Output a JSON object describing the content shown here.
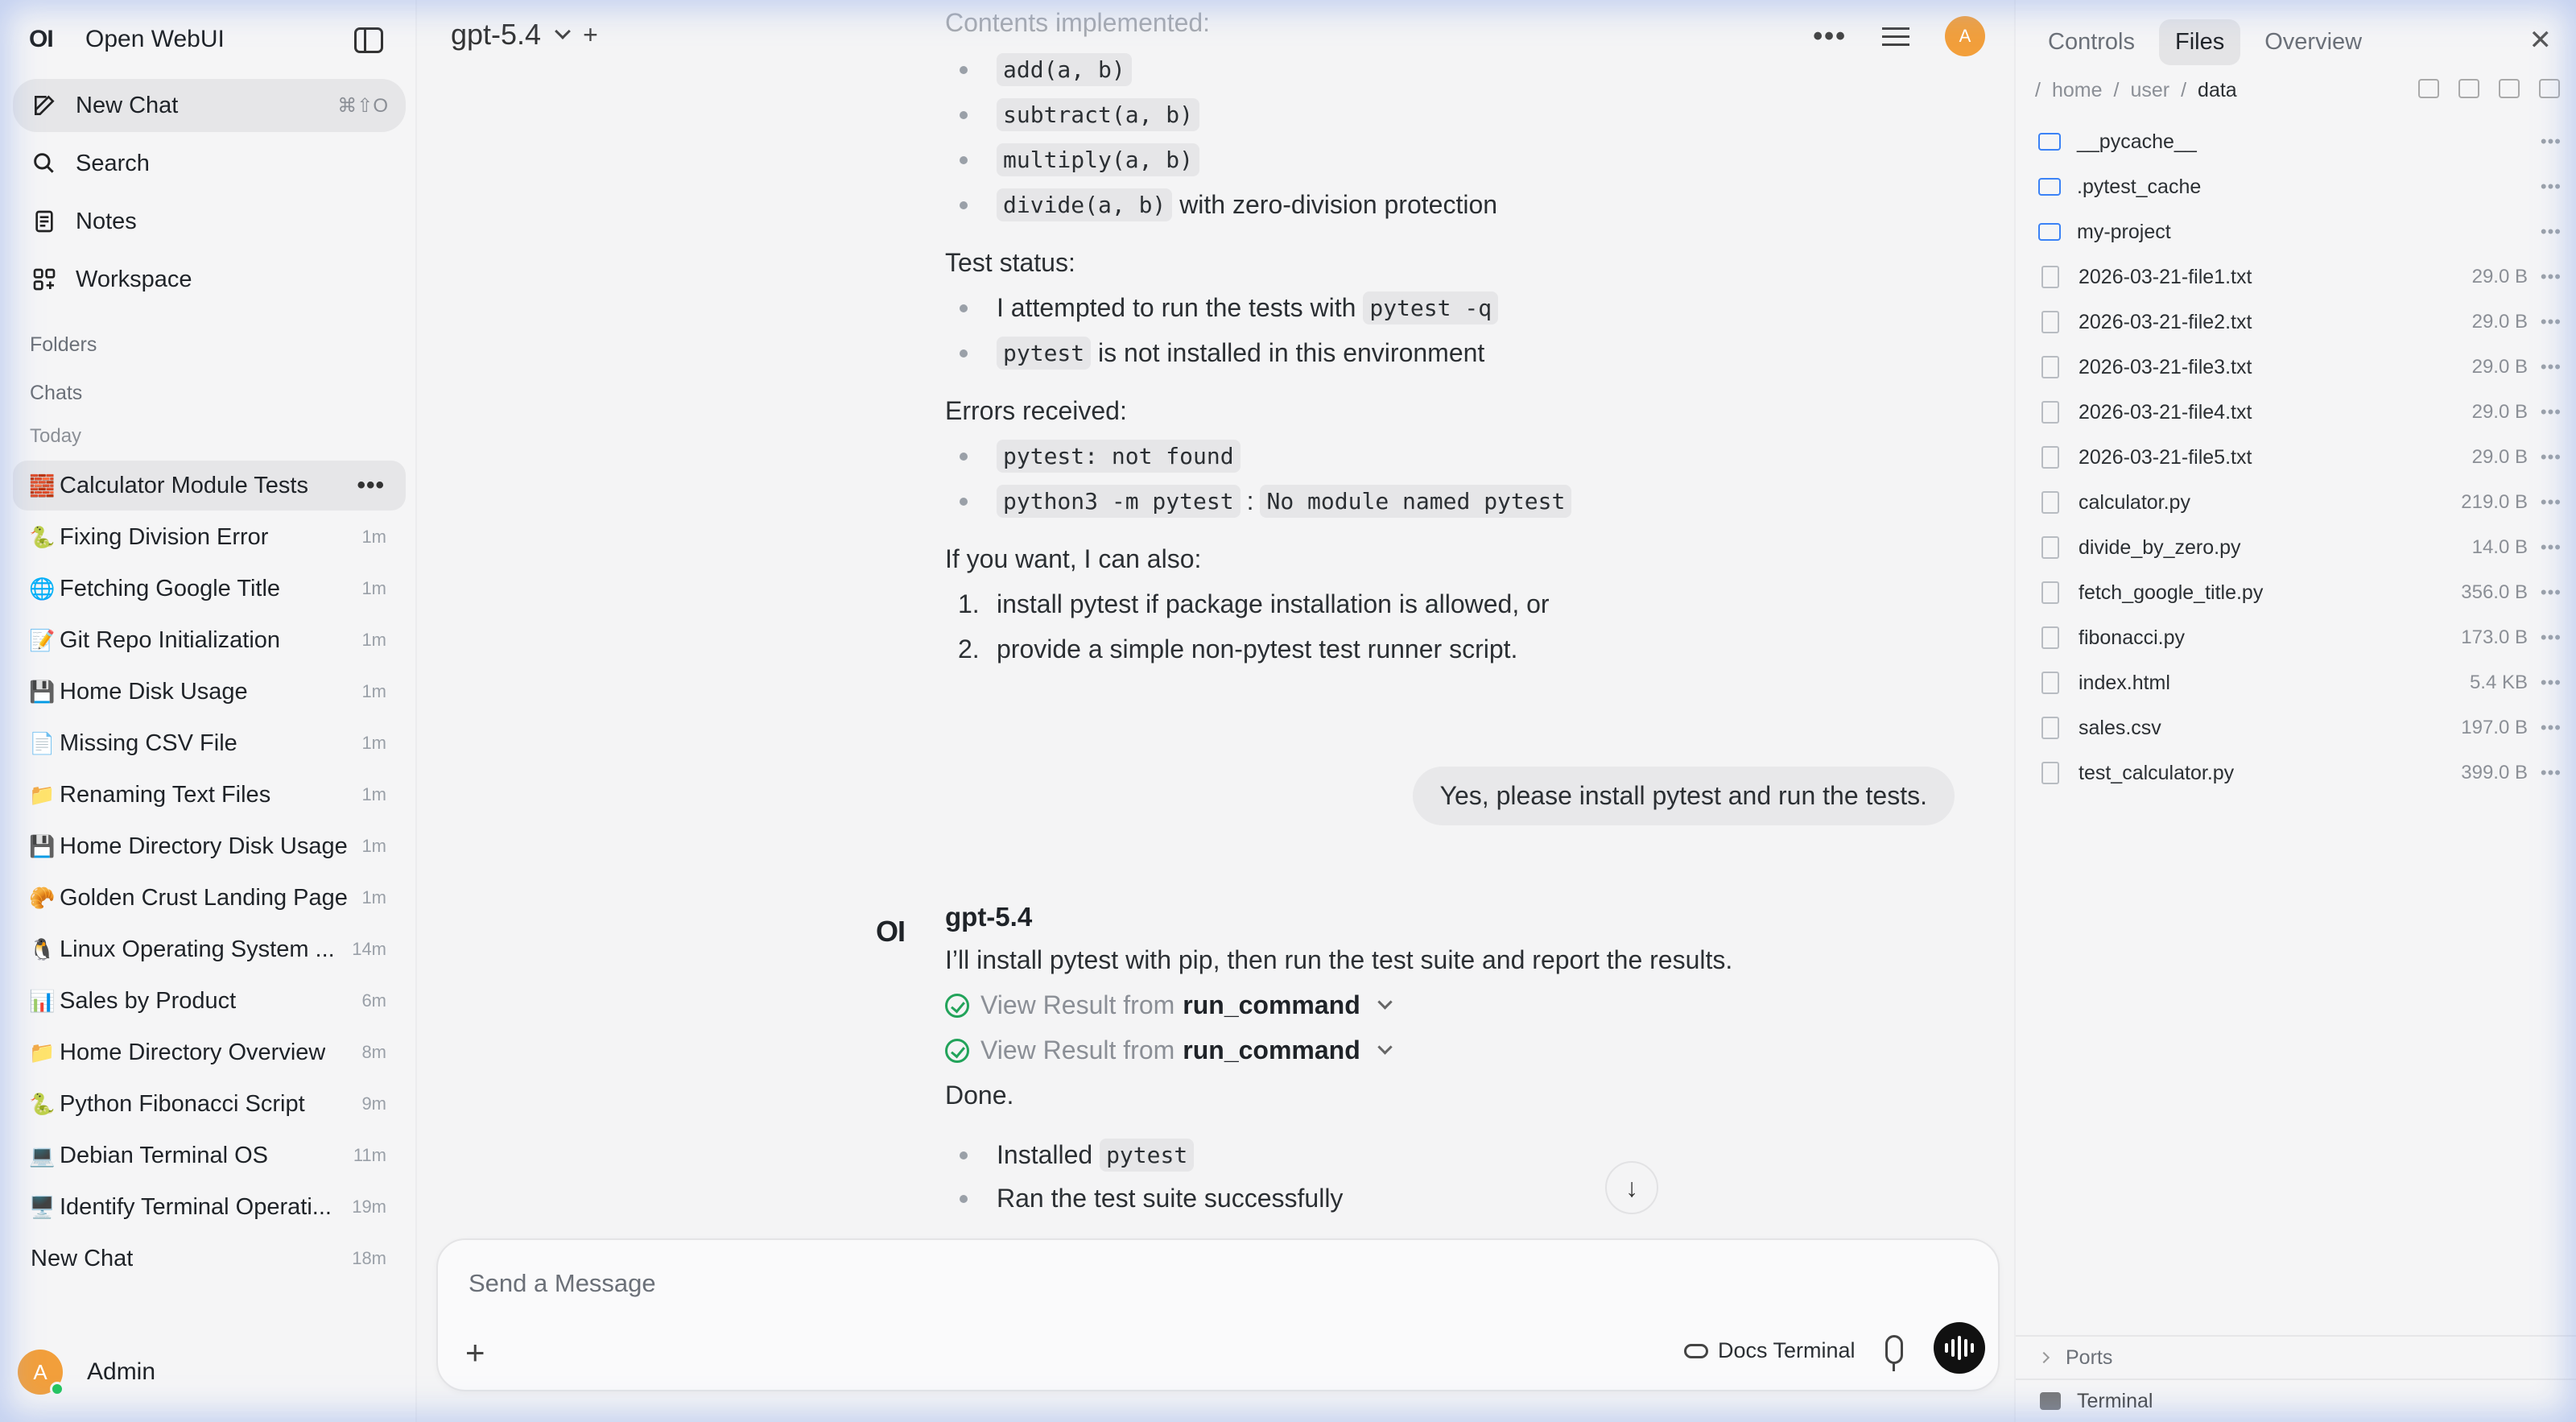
{
  "app": {
    "name": "Open WebUI",
    "logo": "OI"
  },
  "sidebar": {
    "nav": [
      {
        "label": "New Chat",
        "shortcut": "⌘⇧O",
        "icon": "edit-icon"
      },
      {
        "label": "Search",
        "icon": "search-icon"
      },
      {
        "label": "Notes",
        "icon": "notes-icon"
      },
      {
        "label": "Workspace",
        "icon": "workspace-icon"
      }
    ],
    "sections": {
      "folders": "Folders",
      "chats": "Chats",
      "today": "Today"
    },
    "chats": [
      {
        "emoji": "🧱",
        "title": "Calculator Module Tests",
        "time": "",
        "more": "•••"
      },
      {
        "emoji": "🐍",
        "title": "Fixing Division Error",
        "time": "1m"
      },
      {
        "emoji": "🌐",
        "title": "Fetching Google Title",
        "time": "1m"
      },
      {
        "emoji": "📝",
        "title": "Git Repo Initialization",
        "time": "1m"
      },
      {
        "emoji": "💾",
        "title": "Home Disk Usage",
        "time": "1m"
      },
      {
        "emoji": "📄",
        "title": "Missing CSV File",
        "time": "1m"
      },
      {
        "emoji": "📁",
        "title": "Renaming Text Files",
        "time": "1m"
      },
      {
        "emoji": "💾",
        "title": "Home Directory Disk Usage",
        "time": "1m"
      },
      {
        "emoji": "🥐",
        "title": "Golden Crust Landing Page",
        "time": "1m"
      },
      {
        "emoji": "🐧",
        "title": "Linux Operating System ...",
        "time": "14m"
      },
      {
        "emoji": "📊",
        "title": "Sales by Product",
        "time": "6m"
      },
      {
        "emoji": "📁",
        "title": "Home Directory Overview",
        "time": "8m"
      },
      {
        "emoji": "🐍",
        "title": "Python Fibonacci Script",
        "time": "9m"
      },
      {
        "emoji": "💻",
        "title": "Debian Terminal OS",
        "time": "11m"
      },
      {
        "emoji": "🖥️",
        "title": "Identify Terminal Operati...",
        "time": "19m"
      },
      {
        "emoji": "",
        "title": "New Chat",
        "time": "18m"
      }
    ],
    "user": {
      "initial": "A",
      "name": "Admin"
    }
  },
  "header": {
    "model": "gpt-5.4",
    "plus": "+",
    "more": "•••",
    "avatar": "A"
  },
  "conversation": {
    "faded_heading": "Contents implemented:",
    "impl": [
      {
        "code": "add(a, b)",
        "text": ""
      },
      {
        "code": "subtract(a, b)",
        "text": ""
      },
      {
        "code": "multiply(a, b)",
        "text": ""
      },
      {
        "code": "divide(a, b)",
        "text": "with zero-division protection"
      }
    ],
    "test_status": "Test status:",
    "status_items": [
      {
        "pre": "I attempted to run the tests with",
        "code": "pytest -q"
      },
      {
        "code": "pytest",
        "post": "is not installed in this environment"
      }
    ],
    "errors_heading": "Errors received:",
    "errors": [
      {
        "code": "pytest: not found"
      },
      {
        "code": "python3 -m pytest",
        "sep": ":",
        "code2": "No module named pytest"
      }
    ],
    "offer": "If you want, I can also:",
    "options": [
      {
        "n": "1.",
        "text": "install pytest if package installation is allowed, or"
      },
      {
        "n": "2.",
        "text": "provide a simple non-pytest test runner script."
      }
    ],
    "user_message": "Yes, please install pytest and run the tests.",
    "assistant": {
      "logo": "OI",
      "name": "gpt-5.4",
      "intro": "I’ll install pytest with pip, then run the test suite and report the results.",
      "tools": [
        {
          "prefix": "View Result from",
          "name": "run_command"
        },
        {
          "prefix": "View Result from",
          "name": "run_command"
        }
      ],
      "done": "Done.",
      "results": [
        {
          "pre": "Installed",
          "code": "pytest"
        },
        {
          "pre": "Ran the test suite successfully"
        }
      ]
    }
  },
  "composer": {
    "placeholder": "Send a Message",
    "plus": "+",
    "docs_terminal": "Docs Terminal"
  },
  "right_panel": {
    "tabs": [
      "Controls",
      "Files",
      "Overview"
    ],
    "active_tab": "Files",
    "close": "✕",
    "breadcrumb": [
      "/",
      "home",
      "/",
      "user",
      "/",
      "data"
    ],
    "files": [
      {
        "name": "__pycache__",
        "type": "folder",
        "size": ""
      },
      {
        "name": ".pytest_cache",
        "type": "folder",
        "size": ""
      },
      {
        "name": "my-project",
        "type": "folder",
        "size": ""
      },
      {
        "name": "2026-03-21-file1.txt",
        "type": "file",
        "size": "29.0 B"
      },
      {
        "name": "2026-03-21-file2.txt",
        "type": "file",
        "size": "29.0 B"
      },
      {
        "name": "2026-03-21-file3.txt",
        "type": "file",
        "size": "29.0 B"
      },
      {
        "name": "2026-03-21-file4.txt",
        "type": "file",
        "size": "29.0 B"
      },
      {
        "name": "2026-03-21-file5.txt",
        "type": "file",
        "size": "29.0 B"
      },
      {
        "name": "calculator.py",
        "type": "file",
        "size": "219.0 B"
      },
      {
        "name": "divide_by_zero.py",
        "type": "file",
        "size": "14.0 B"
      },
      {
        "name": "fetch_google_title.py",
        "type": "file",
        "size": "356.0 B"
      },
      {
        "name": "fibonacci.py",
        "type": "file",
        "size": "173.0 B"
      },
      {
        "name": "index.html",
        "type": "file",
        "size": "5.4 KB"
      },
      {
        "name": "sales.csv",
        "type": "file",
        "size": "197.0 B"
      },
      {
        "name": "test_calculator.py",
        "type": "file",
        "size": "399.0 B"
      }
    ],
    "file_more": "•••",
    "ports": "Ports",
    "terminal": "Terminal"
  },
  "colors": {
    "accent_avatar": "#f29f3b",
    "online": "#22c55e",
    "success": "#22a35a",
    "folder": "#3b82f6"
  }
}
